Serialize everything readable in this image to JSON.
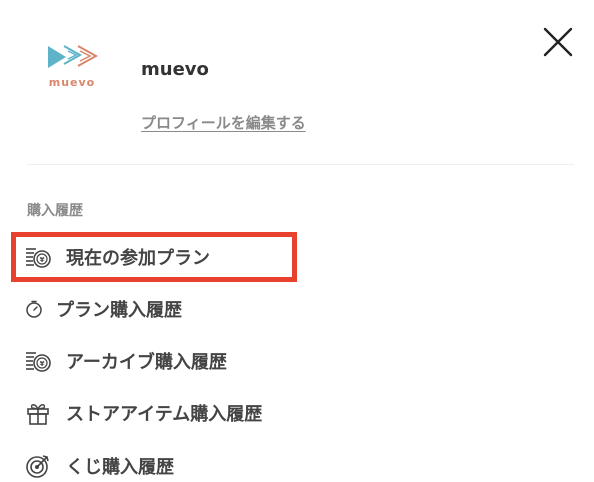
{
  "header": {
    "logo_text": "muevo",
    "user_name": "muevo",
    "edit_profile_label": "プロフィールを編集する",
    "close_icon": "close-icon"
  },
  "purchase_history": {
    "heading": "購入履歴",
    "items": [
      {
        "label": "現在の参加プラン",
        "icon": "coin-stack-icon",
        "highlighted": true
      },
      {
        "label": "プラン購入履歴",
        "icon": "timer-icon",
        "highlighted": false
      },
      {
        "label": "アーカイブ購入履歴",
        "icon": "coin-stack-icon",
        "highlighted": false
      },
      {
        "label": "ストアアイテム購入履歴",
        "icon": "gift-icon",
        "highlighted": false
      },
      {
        "label": "くじ購入履歴",
        "icon": "target-icon",
        "highlighted": false
      }
    ]
  },
  "colors": {
    "highlight": "#e8412d",
    "logo_blue": "#5fb3c9",
    "logo_orange": "#d9876c",
    "text_primary": "#333333",
    "text_muted": "#8a8a8a"
  }
}
